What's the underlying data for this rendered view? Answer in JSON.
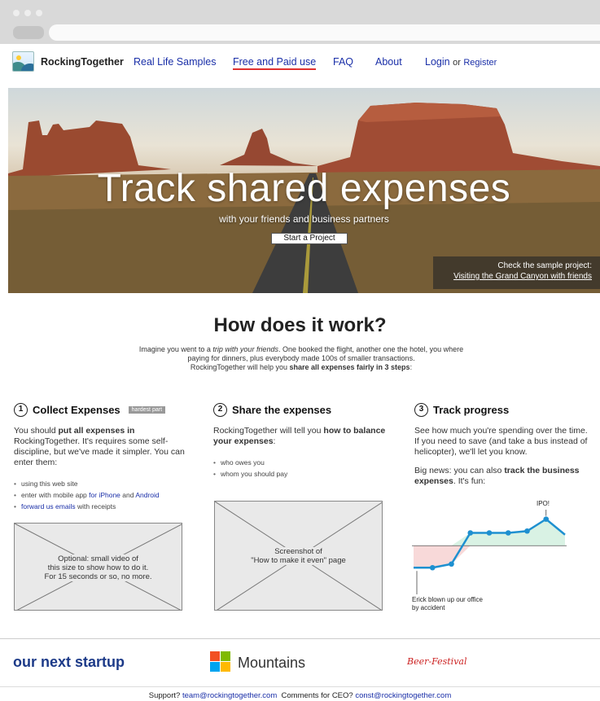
{
  "nav": {
    "brand": "RockingTogether",
    "links": [
      "Real Life Samples",
      "Free and Paid use",
      "FAQ",
      "About"
    ],
    "login": "Login",
    "or": "or",
    "register": "Register"
  },
  "hero": {
    "title": "Track shared expenses",
    "subtitle": "with your friends and business partners",
    "cta": "Start a Project",
    "sample_intro": "Check the sample project:",
    "sample_link": "Visiting the Grand Canyon with friends"
  },
  "how": {
    "title": "How does it work?",
    "intro_1": "Imagine you went to a ",
    "intro_em": "trip with your friends",
    "intro_2": ". One booked the flight, another one the hotel, you where paying for dinners, plus everybody made 100s of smaller transactions.",
    "intro_3": "RockingTogether will help you ",
    "intro_bold": "share all expenses fairly in 3 steps",
    "intro_4": ":"
  },
  "steps": [
    {
      "num": "1",
      "title": "Collect Expenses",
      "badge": "hardest part",
      "p1": "You should ",
      "p1_bold": "put all expenses in",
      "p2": " RockingTogether. It's requires some self-discipline, but we've made it simpler. You can enter them:",
      "bullets": {
        "b1": "using this web site",
        "b2_a": "enter with mobile app ",
        "b2_link1": "for iPhone",
        "b2_b": " and ",
        "b2_link2": "Android",
        "b3_link": "forward us emails",
        "b3_b": " with receipts"
      },
      "placeholder": [
        "Optional: small video of",
        "this size to show how to do it.",
        "For 15 seconds or so, no more."
      ]
    },
    {
      "num": "2",
      "title": "Share the expenses",
      "p1": "RockingTogether will tell you ",
      "p1_bold": "how to balance your expenses",
      "p2": ":",
      "bullets": [
        "who owes you",
        "whom you should pay"
      ],
      "placeholder": [
        "Screenshot of",
        "\"How to make it even\" page"
      ]
    },
    {
      "num": "3",
      "title": "Track progress",
      "p1": "See how much you're spending over the time. If you need to save (and take a bus instead of helicopter), we'll let you know.",
      "p2a": "Big news: you can also ",
      "p2_bold": "track the business expenses",
      "p2b": ". It's fun:",
      "chart_label_top": "IPO!",
      "chart_label_bottom": [
        "Erick blown up our office",
        "by accident"
      ]
    }
  ],
  "progress_chart": {
    "type": "line",
    "points": [
      22,
      22,
      26,
      60,
      60,
      60,
      62,
      75,
      58
    ],
    "baseline": 46
  },
  "footer": {
    "startup": "our next startup",
    "mountains": "Mountains",
    "beer": "Beer-Festival",
    "support": "Support?",
    "support_email": "team@rockingtogether.com",
    "ceo": "Comments for CEO?",
    "ceo_email": "const@rockingtogether.com"
  },
  "colors": {
    "link": "#1a2fa8",
    "nav_active_underline": "#e0302f",
    "chart_line": "#1e90d0",
    "startup_blue": "#1c3a88",
    "mountains_logo": [
      "#f25022",
      "#7fba00",
      "#00a4ef",
      "#ffb900"
    ]
  }
}
